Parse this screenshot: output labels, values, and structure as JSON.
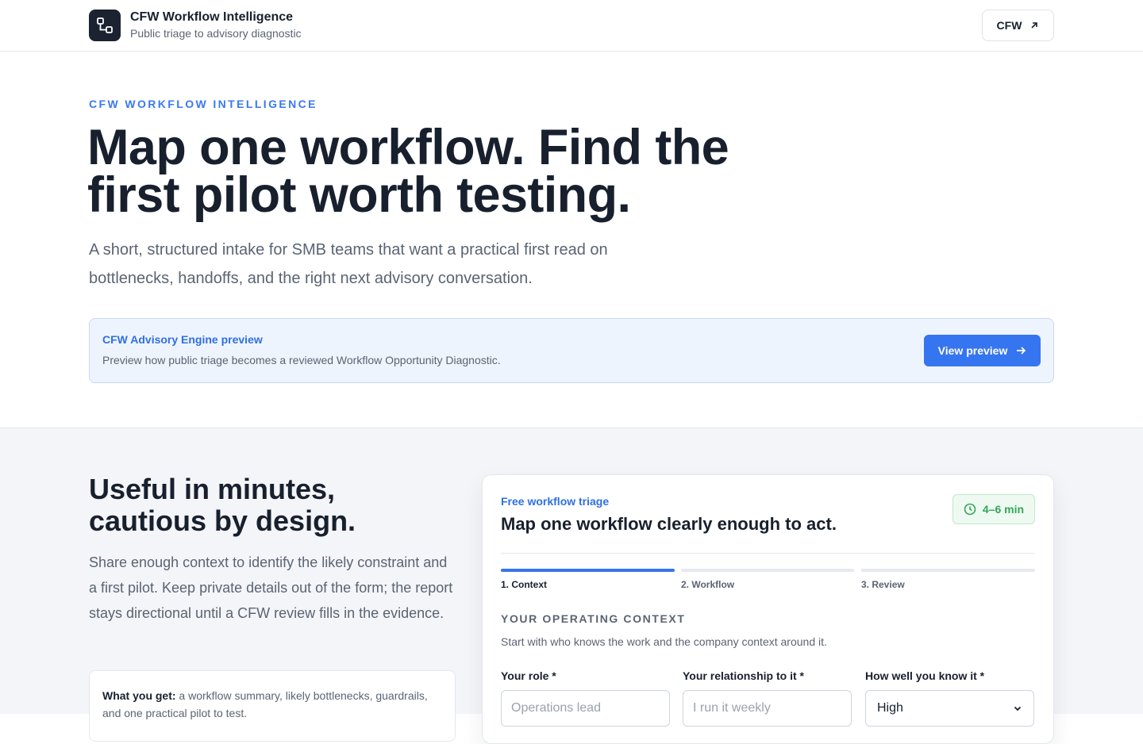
{
  "header": {
    "title": "CFW Workflow Intelligence",
    "subtitle": "Public triage to advisory diagnostic",
    "link_label": "CFW"
  },
  "hero": {
    "eyebrow": "CFW WORKFLOW INTELLIGENCE",
    "title": "Map one workflow. Find the first pilot worth testing.",
    "lead": "A short, structured intake for SMB teams that want a practical first read on bottlenecks, handoffs, and the right next advisory conversation."
  },
  "preview": {
    "title": "CFW Advisory Engine preview",
    "description": "Preview how public triage becomes a reviewed Workflow Opportunity Diagnostic.",
    "button_label": "View preview"
  },
  "intro": {
    "title": "Useful in minutes, cautious by design.",
    "lead": "Share enough context to identify the likely constraint and a first pilot. Keep private details out of the form; the report stays directional until a CFW review fills in the evidence.",
    "what_you_get_label": "What you get:",
    "what_you_get_text": " a workflow summary, likely bottlenecks, guardrails, and one practical pilot to test."
  },
  "form": {
    "eyebrow": "Free workflow triage",
    "title": "Map one workflow clearly enough to act.",
    "time_estimate": "4–6 min",
    "steps": [
      {
        "label": "1. Context",
        "active": true
      },
      {
        "label": "2. Workflow",
        "active": false
      },
      {
        "label": "3. Review",
        "active": false
      }
    ],
    "section_title": "YOUR OPERATING CONTEXT",
    "section_subtitle": "Start with who knows the work and the company context around it.",
    "fields": [
      {
        "label": "Your role *",
        "placeholder": "Operations lead"
      },
      {
        "label": "Your relationship to it *",
        "placeholder": "I run it weekly"
      },
      {
        "label": "How well you know it *",
        "value": "High"
      }
    ]
  },
  "colors": {
    "accent": "#3675f0",
    "success": "#35a55a",
    "ink": "#18202e"
  }
}
